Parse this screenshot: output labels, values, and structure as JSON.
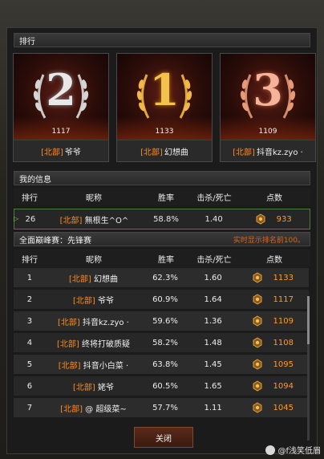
{
  "window": {
    "title": "排行"
  },
  "podium": [
    {
      "rank": "2",
      "score": "1117",
      "region": "[北部]",
      "name": "爷爷",
      "tier": "silver"
    },
    {
      "rank": "1",
      "score": "1133",
      "region": "[北部]",
      "name": "幻想曲",
      "tier": "gold"
    },
    {
      "rank": "3",
      "score": "1109",
      "region": "[北部]",
      "name": "抖音kz.zyo ·",
      "tier": "bronze"
    }
  ],
  "my_info": {
    "section_title": "我的信息",
    "headers": {
      "rank": "排行",
      "name": "昵称",
      "win_rate": "胜率",
      "kd": "击杀/死亡",
      "points": "点数"
    },
    "row": {
      "rank": "26",
      "region": "[北部]",
      "name": "無根生^O^",
      "win_rate": "58.8%",
      "kd": "1.40",
      "points": "933"
    }
  },
  "leaderboard": {
    "section_title": "全面巅峰赛：先锋赛",
    "note": "实时显示排名前100。",
    "headers": {
      "rank": "排行",
      "name": "昵称",
      "win_rate": "胜率",
      "kd": "击杀/死亡",
      "points": "点数"
    },
    "rows": [
      {
        "rank": "1",
        "region": "[北部]",
        "name": "幻想曲",
        "win_rate": "62.3%",
        "kd": "1.60",
        "points": "1133"
      },
      {
        "rank": "2",
        "region": "[北部]",
        "name": "爷爷",
        "win_rate": "60.9%",
        "kd": "1.64",
        "points": "1117"
      },
      {
        "rank": "3",
        "region": "[北部]",
        "name": "抖音kz.zyo ·",
        "win_rate": "59.6%",
        "kd": "1.36",
        "points": "1109"
      },
      {
        "rank": "4",
        "region": "[北部]",
        "name": "终将打破质疑",
        "win_rate": "58.2%",
        "kd": "1.48",
        "points": "1108"
      },
      {
        "rank": "5",
        "region": "[北部]",
        "name": "抖音小白菜 ·",
        "win_rate": "63.8%",
        "kd": "1.45",
        "points": "1095"
      },
      {
        "rank": "6",
        "region": "[北部]",
        "name": "姥爷",
        "win_rate": "60.5%",
        "kd": "1.65",
        "points": "1094"
      },
      {
        "rank": "7",
        "region": "[北部]",
        "name": "@ 超级菜~",
        "win_rate": "57.7%",
        "kd": "1.11",
        "points": "1045"
      }
    ]
  },
  "footer": {
    "close_label": "关闭",
    "watermark": "@f浅笑低眉"
  },
  "colors": {
    "accent_orange": "#ff8a1f",
    "note_red": "#e0631b",
    "my_row_border": "#4e7a3a"
  },
  "icons": {
    "points": "medal-icon",
    "marker": "arrow-marker-icon"
  }
}
